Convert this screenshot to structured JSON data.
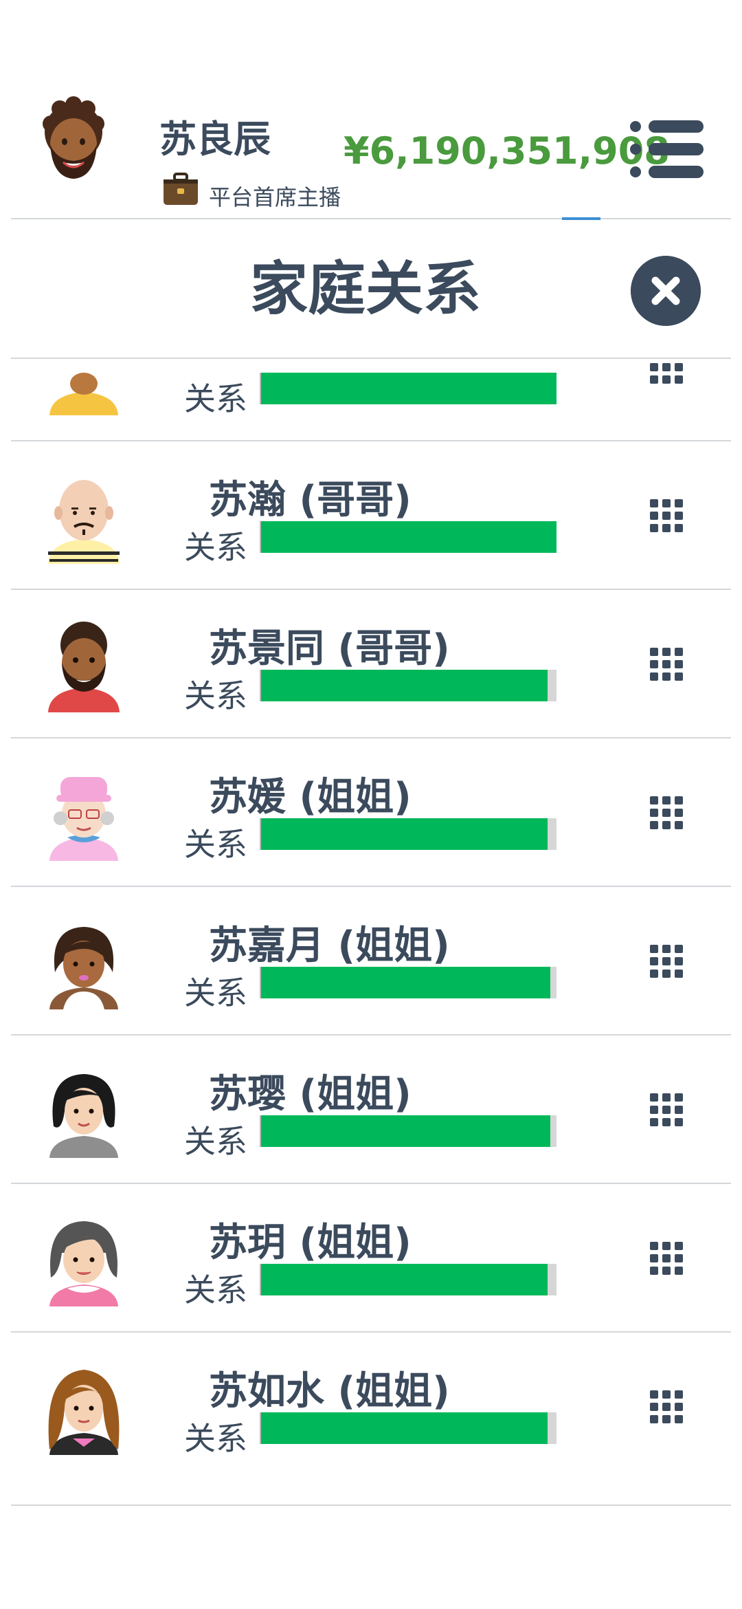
{
  "header": {
    "player_name": "苏良辰",
    "job_title": "平台首席主播",
    "money": "¥6,190,351,908"
  },
  "modal": {
    "title": "家庭关系"
  },
  "relationship_label": "关系",
  "members": [
    {
      "name": "",
      "relationship": 1.0,
      "avatar": "avatar-woman-yellow"
    },
    {
      "name": "苏瀚 (哥哥)",
      "relationship": 1.0,
      "avatar": "avatar-bald-man-mustache"
    },
    {
      "name": "苏景同 (哥哥)",
      "relationship": 0.97,
      "avatar": "avatar-man-beard"
    },
    {
      "name": "苏媛 (姐姐)",
      "relationship": 0.97,
      "avatar": "avatar-elderly-woman-hat"
    },
    {
      "name": "苏嘉月 (姐姐)",
      "relationship": 0.98,
      "avatar": "avatar-woman-short-hair"
    },
    {
      "name": "苏璎 (姐姐)",
      "relationship": 0.98,
      "avatar": "avatar-woman-black-hair"
    },
    {
      "name": "苏玥 (姐姐)",
      "relationship": 0.97,
      "avatar": "avatar-woman-gray-hair"
    },
    {
      "name": "苏如水 (姐姐)",
      "relationship": 0.97,
      "avatar": "avatar-woman-long-hair"
    }
  ],
  "colors": {
    "text": "#3b4a5c",
    "money": "#4a9a3e",
    "bar_fill": "#00b85a",
    "bar_track": "#d6d6d6",
    "divider": "#d4d7da"
  }
}
